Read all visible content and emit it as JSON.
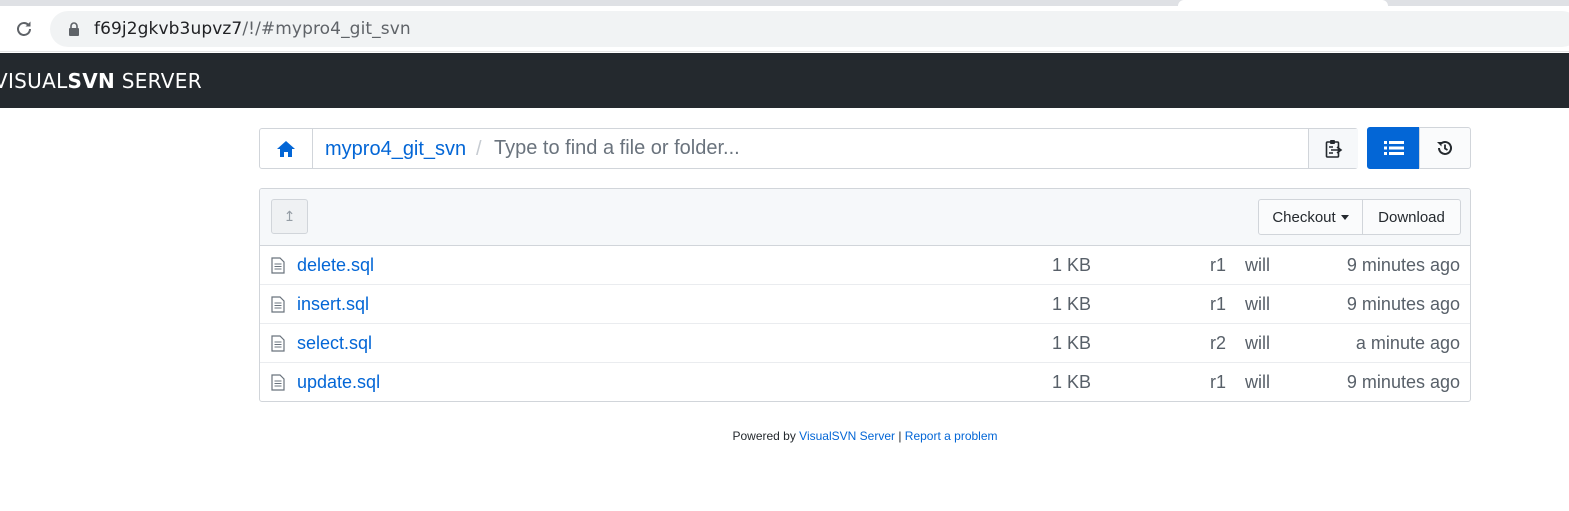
{
  "browser": {
    "url_host": "f69j2gkvb3upvz7",
    "url_path": "/!/#mypro4_git_svn"
  },
  "header": {
    "brand_visual": "VISUAL",
    "brand_svn": "SVN",
    "brand_server": " SERVER"
  },
  "breadcrumb": {
    "repo": "mypro4_git_svn",
    "separator": "/",
    "search_placeholder": "Type to find a file or folder..."
  },
  "toolbar": {
    "checkout_label": "Checkout",
    "download_label": "Download",
    "up_label": "↥"
  },
  "files": [
    {
      "name": "delete.sql",
      "size": "1 KB",
      "rev": "r1",
      "author": "will",
      "time": "9 minutes ago"
    },
    {
      "name": "insert.sql",
      "size": "1 KB",
      "rev": "r1",
      "author": "will",
      "time": "9 minutes ago"
    },
    {
      "name": "select.sql",
      "size": "1 KB",
      "rev": "r2",
      "author": "will",
      "time": "a minute ago"
    },
    {
      "name": "update.sql",
      "size": "1 KB",
      "rev": "r1",
      "author": "will",
      "time": "9 minutes ago"
    }
  ],
  "footer": {
    "powered_by": "Powered by ",
    "product": "VisualSVN Server",
    "separator": " | ",
    "report": "Report a problem"
  },
  "colors": {
    "accent": "#0366d6",
    "header_bg": "#24292e"
  }
}
